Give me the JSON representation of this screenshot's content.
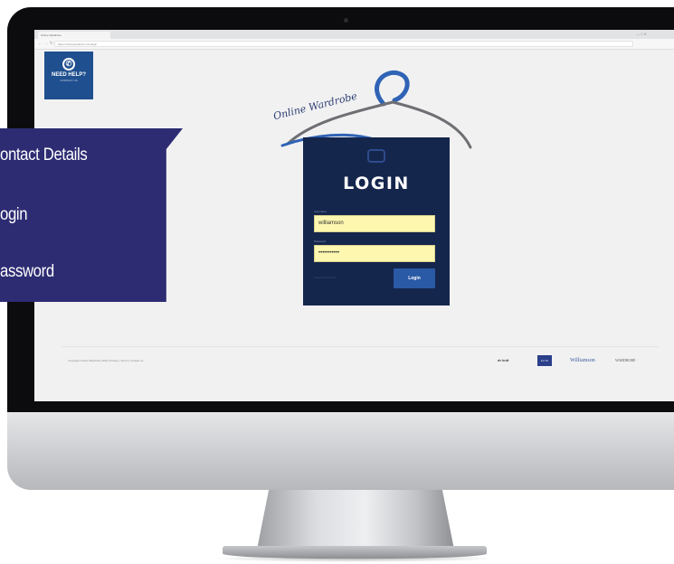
{
  "browser": {
    "tab_title": "Online Wardrobe",
    "url": "https://onlinewardrobe.com/login",
    "nav_icons": "← → ↻",
    "window_controls": "— □ ✕"
  },
  "help_badge": {
    "icon": "whatsapp-icon",
    "glyph": "✆",
    "label": "NEED HELP?",
    "sub_label": "CONTACT US"
  },
  "brand": {
    "logo_text": "Online Wardrobe",
    "hanger_color": "#2f63b5"
  },
  "login_form": {
    "title": "LOGIN",
    "username_label": "Username",
    "username_value": "williamson",
    "password_label": "Password",
    "password_value": "•••••••••••",
    "remember_text": "Forgot Password?",
    "button_label": "Login"
  },
  "footer": {
    "copyright": "Copyright Online Wardrobe 2019 | Privacy | Terms | Contact us",
    "partners": [
      "dr knit",
      "ELITE",
      "Williamson",
      "WARDROBE"
    ]
  },
  "overlay_menu": {
    "items": [
      "ontact Details",
      "ogin",
      "assword"
    ],
    "background": "#2d2c73"
  },
  "colors": {
    "card_bg": "#15264d",
    "accent": "#2a5aa6",
    "input_bg": "#fdf7b0"
  }
}
